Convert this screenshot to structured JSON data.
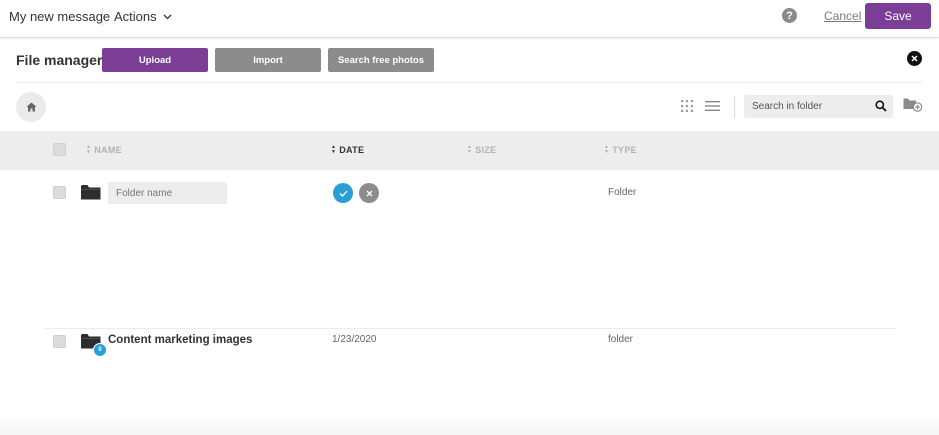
{
  "topbar": {
    "message_title": "My new message",
    "actions_label": "Actions",
    "help_glyph": "?",
    "cancel_label": "Cancel",
    "save_label": "Save"
  },
  "file_manager": {
    "title": "File manager",
    "upload_label": "Upload",
    "import_label": "Import",
    "search_photos_label": "Search free photos"
  },
  "toolbar": {
    "search_placeholder": "Search in folder"
  },
  "table": {
    "columns": [
      {
        "label": "NAME",
        "active": false
      },
      {
        "label": "DATE",
        "active": true
      },
      {
        "label": "SIZE",
        "active": false
      },
      {
        "label": "TYPE",
        "active": false
      }
    ],
    "new_folder_row": {
      "name_placeholder": "Folder name",
      "type": "Folder"
    },
    "rows": [
      {
        "name": "Content marketing images",
        "date": "1/23/2020",
        "type": "folder",
        "badge_count": "0"
      }
    ]
  },
  "colors": {
    "brand_purple": "#7b3e94",
    "secondary_gray": "#8c8c8c",
    "confirm_blue": "#2a9fd6"
  },
  "icons": [
    "chevron-down-icon",
    "help-icon",
    "close-icon",
    "home-icon",
    "grid-view-icon",
    "list-view-icon",
    "search-icon",
    "new-folder-icon",
    "folder-icon",
    "check-icon",
    "x-icon",
    "sort-icon"
  ]
}
